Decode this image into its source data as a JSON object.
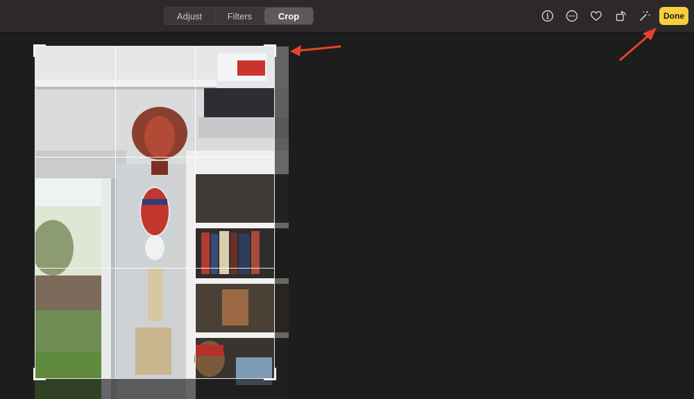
{
  "toolbar": {
    "tabs": [
      {
        "label": "Adjust"
      },
      {
        "label": "Filters"
      },
      {
        "label": "Crop"
      }
    ],
    "active_tab": "Crop",
    "icons": [
      "info-icon",
      "more-icon",
      "heart-icon",
      "rotate-icon",
      "magic-wand-icon"
    ],
    "done_label": "Done"
  },
  "colors": {
    "accent": "#f8cd3f",
    "annotation": "#e8432a",
    "toolbar_bg": "#2c2928",
    "canvas_bg": "#1e1d1d"
  }
}
